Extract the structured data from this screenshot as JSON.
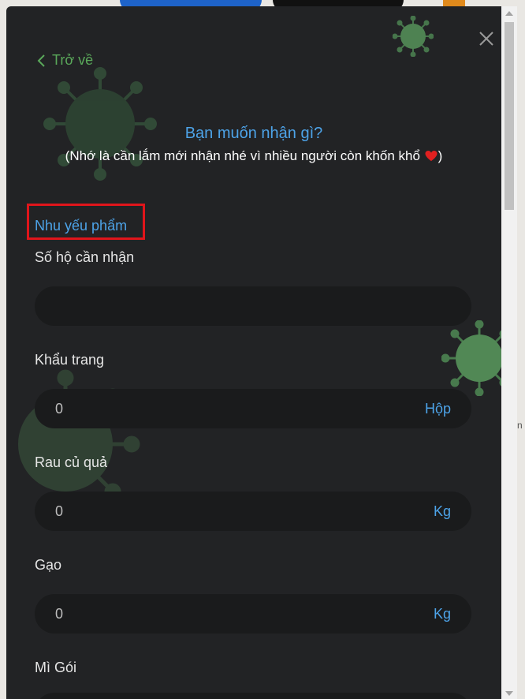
{
  "back_label": "Trở về",
  "title": "Bạn muốn nhận gì?",
  "subtitle": "(Nhớ là cần lắm mới nhận nhé vì nhiều người còn khốn khổ ",
  "subtitle_end": ")",
  "section_title": "Nhu yếu phẩm",
  "fields": [
    {
      "label": "Số hộ cần nhận",
      "value": "",
      "unit": ""
    },
    {
      "label": "Khẩu trang",
      "value": "0",
      "unit": "Hộp"
    },
    {
      "label": "Rau củ quả",
      "value": "0",
      "unit": "Kg"
    },
    {
      "label": "Gạo",
      "value": "0",
      "unit": "Kg"
    },
    {
      "label": "Mì Gói",
      "value": "",
      "unit": ""
    }
  ],
  "background_edge_text": "n",
  "colors": {
    "accent_blue": "#4da3e8",
    "back_green": "#5aa85a",
    "highlight_red": "#e0151b",
    "modal_bg": "#222325"
  },
  "icons": [
    "back-chevron-icon",
    "close-icon",
    "heart-icon",
    "virus-icon"
  ]
}
